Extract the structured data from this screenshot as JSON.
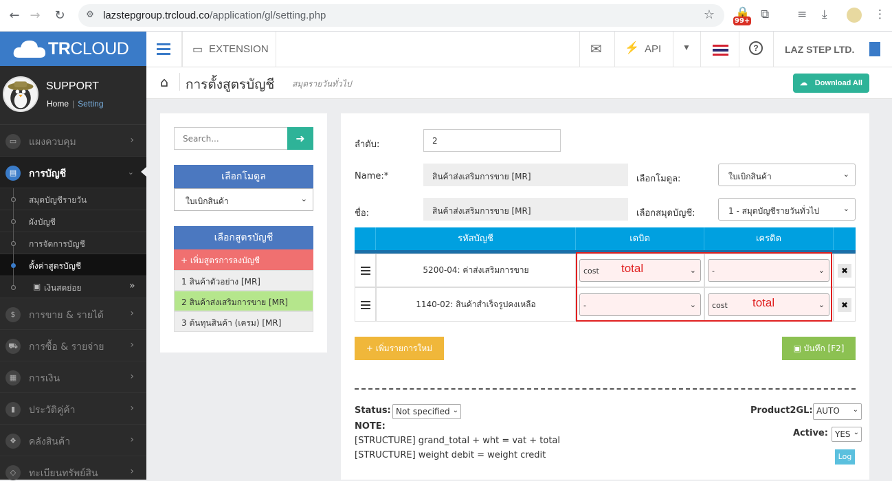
{
  "browser": {
    "url_host": "lazstepgroup.trcloud.co",
    "url_path": "/application/gl/setting.php",
    "badge": "99+"
  },
  "brand": {
    "name_bold": "TR",
    "name_rest": "CLOUD"
  },
  "profile": {
    "name": "SUPPORT",
    "crumb_home": "Home",
    "crumb_sep": "|",
    "crumb_current": "Setting"
  },
  "sidebar": {
    "items": [
      {
        "label": "แผงควบคุม",
        "icon": "monitor-icon"
      },
      {
        "label": "การบัญชี",
        "icon": "book-icon",
        "active": true
      },
      {
        "label": "การขาย & รายได้",
        "icon": "dollar-icon"
      },
      {
        "label": "การซื้อ & รายจ่าย",
        "icon": "cart-icon"
      },
      {
        "label": "การเงิน",
        "icon": "calendar-icon"
      },
      {
        "label": "ประวัติคู่ค้า",
        "icon": "contact-icon"
      },
      {
        "label": "คลังสินค้า",
        "icon": "cubes-icon"
      },
      {
        "label": "ทะเบียนทรัพย์สิน",
        "icon": "diamond-icon"
      }
    ],
    "sub_items": [
      {
        "label": "สมุดบัญชีรายวัน"
      },
      {
        "label": "ผังบัญชี"
      },
      {
        "label": "การจัดการบัญชี"
      },
      {
        "label": "ตั้งค่าสูตรบัญชี",
        "active": true
      },
      {
        "label": "เงินสดย่อย"
      }
    ]
  },
  "topbar": {
    "extension": "EXTENSION",
    "api": "API",
    "company": "LAZ STEP LTD."
  },
  "page": {
    "title": "การตั้งสูตรบัญชี",
    "subtitle": "สมุดรายวันทั่วไป",
    "download_all": "Download All"
  },
  "left": {
    "search_placeholder": "Search...",
    "module_header": "เลือกโมดูล",
    "module_value": "ใบเบิกสินค้า",
    "formula_header": "เลือกสูตรบัญชี",
    "add_formula": "+ เพิ่มสูตรการลงบัญชี",
    "formulas": [
      {
        "label": "1 สินค้าตัวอย่าง [MR]"
      },
      {
        "label": "2 สินค้าส่งเสริมการขาย [MR]",
        "selected": true
      },
      {
        "label": "3 ต้นทุนสินค้า (เครม) [MR]"
      }
    ]
  },
  "form": {
    "order_label": "ลำดับ:",
    "order_value": "2",
    "name_label": "Name:*",
    "name_value": "สินค้าส่งเสริมการขาย [MR]",
    "thname_label": "ชื่อ:",
    "thname_value": "สินค้าส่งเสริมการขาย [MR]",
    "module_label": "เลือกโมดูล:",
    "module_value": "ใบเบิกสินค้า",
    "journal_label": "เลือกสมุดบัญชี:",
    "journal_value": "1 - สมุดบัญชีรายวันทั่วไป"
  },
  "table": {
    "headers": [
      "รหัสบัญชี",
      "เดบิต",
      "เครดิต"
    ],
    "rows": [
      {
        "account": "5200-04: ค่าส่งเสริมการขาย",
        "debit": "cost",
        "debit_note": "total",
        "credit": "-",
        "credit_note": ""
      },
      {
        "account": "1140-02: สินค้าสำเร็จรูปคงเหลือ",
        "debit": "-",
        "debit_note": "",
        "credit": "cost",
        "credit_note": "total"
      }
    ]
  },
  "buttons": {
    "add_item": "+ เพิ่มรายการใหม่",
    "save": "บันทึก [F2]",
    "log": "Log"
  },
  "footer": {
    "status_label": "Status:",
    "status_value": "Not specified",
    "note_label": "NOTE:",
    "structure1": "[STRUCTURE] grand_total + wht = vat + total",
    "structure2": "[STRUCTURE] weight debit = weight credit",
    "product2gl_label": "Product2GL:",
    "product2gl_value": "AUTO",
    "active_label": "Active:",
    "active_value": "YES"
  },
  "colors": {
    "brand": "#3a7bc8",
    "table_header": "#00a0e0",
    "add_btn": "#f0b73a",
    "save_btn": "#8cc152",
    "download": "#2eb398",
    "highlight": "#e02020"
  }
}
